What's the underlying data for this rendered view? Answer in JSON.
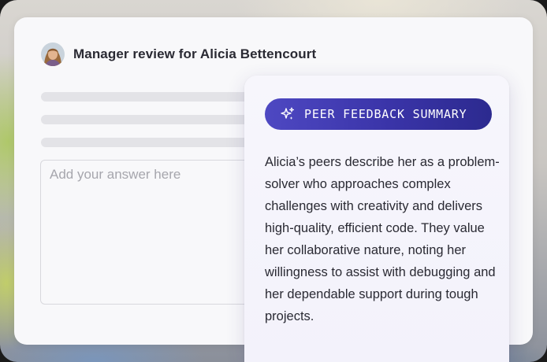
{
  "review": {
    "title": "Manager review for Alicia Bettencourt",
    "answer_placeholder": "Add your answer here"
  },
  "summary": {
    "badge_label": "PEER FEEDBACK SUMMARY",
    "badge_icon": "sparkle-icon",
    "text": "Alicia’s peers describe her as a problem-solver who approaches complex challenges with creativity and delivers high-quality, efficient code. They value her collaborative nature, noting her willingness to assist with debugging and her dependable support during tough projects."
  },
  "colors": {
    "accent": "#3a34a8",
    "card_bg": "#f8f8fa",
    "text": "#2a2a33",
    "placeholder": "#a6a6ad"
  }
}
